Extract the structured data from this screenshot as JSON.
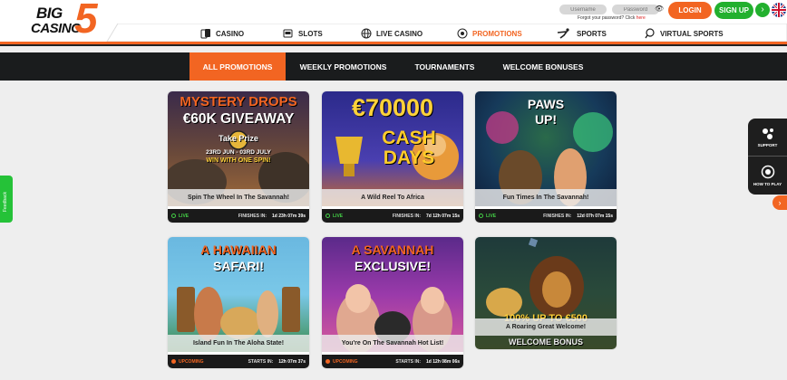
{
  "brand": {
    "logo_big": "BIG",
    "logo_casino": "CASINO",
    "logo_five": "5"
  },
  "auth": {
    "username_placeholder": "Username",
    "password_placeholder": "Password",
    "forgot_text": "Forgot your password? Click",
    "forgot_link": "here",
    "login": "LOGIN",
    "signup": "SIGN UP"
  },
  "nav": {
    "items": [
      {
        "label": "CASINO",
        "icon": "cards-icon"
      },
      {
        "label": "SLOTS",
        "icon": "slot-machine-icon"
      },
      {
        "label": "LIVE CASINO",
        "icon": "globe-icon"
      },
      {
        "label": "PROMOTIONS",
        "icon": "promotion-icon",
        "active": true
      },
      {
        "label": "SPORTS",
        "icon": "soccer-player-icon"
      },
      {
        "label": "VIRTUAL SPORTS",
        "icon": "virtual-sports-icon"
      }
    ]
  },
  "tabs": [
    {
      "label": "ALL PROMOTIONS",
      "active": true
    },
    {
      "label": "WEEKLY PROMOTIONS"
    },
    {
      "label": "TOURNAMENTS"
    },
    {
      "label": "WELCOME BONUSES"
    }
  ],
  "cards": [
    {
      "title1": "MYSTERY DROPS",
      "title2": "€60K GIVEAWAY",
      "brand": "Take Prize",
      "dates": "23RD JUN - 03RD JULY",
      "sub": "WIN WITH ONE SPIN!",
      "caption": "Spin The Wheel In The Savannah!",
      "status": "LIVE",
      "timer_label": "FINISHES IN:",
      "timer": "1d 23h 07m 39s"
    },
    {
      "title1": "€70000",
      "title2": "CASH",
      "title3": "DAYS",
      "caption": "A Wild Reel To Africa",
      "status": "LIVE",
      "timer_label": "FINISHES IN:",
      "timer": "7d 12h 07m 15s"
    },
    {
      "title1": "PAWS",
      "title2": "UP!",
      "caption": "Fun Times In The Savannah!",
      "status": "LIVE",
      "timer_label": "FINISHES IN:",
      "timer": "12d 07h 07m 15s"
    },
    {
      "title1": "A HAWAIIAN",
      "title2": "SAFARI!",
      "caption": "Island Fun In The Aloha State!",
      "status": "UPCOMING",
      "timer_label": "STARTS IN:",
      "timer": "12h 07m 37s"
    },
    {
      "title1": "A SAVANNAH",
      "title2": "EXCLUSIVE!",
      "caption": "You're On The Savannah Hot List!",
      "status": "UPCOMING",
      "timer_label": "STARTS IN:",
      "timer": "1d 12h 08m 06s"
    },
    {
      "title1": "100% UP TO €500",
      "title2": "WELCOME BONUS",
      "caption": "A Roaring Great Welcome!"
    }
  ],
  "side": {
    "support": "SUPPORT",
    "how_to_play": "HOW TO PLAY",
    "feedback": "Feedback"
  },
  "colors": {
    "accent": "#f26522",
    "live": "#44d046",
    "dark": "#1a1c1d",
    "green": "#22b02e"
  }
}
